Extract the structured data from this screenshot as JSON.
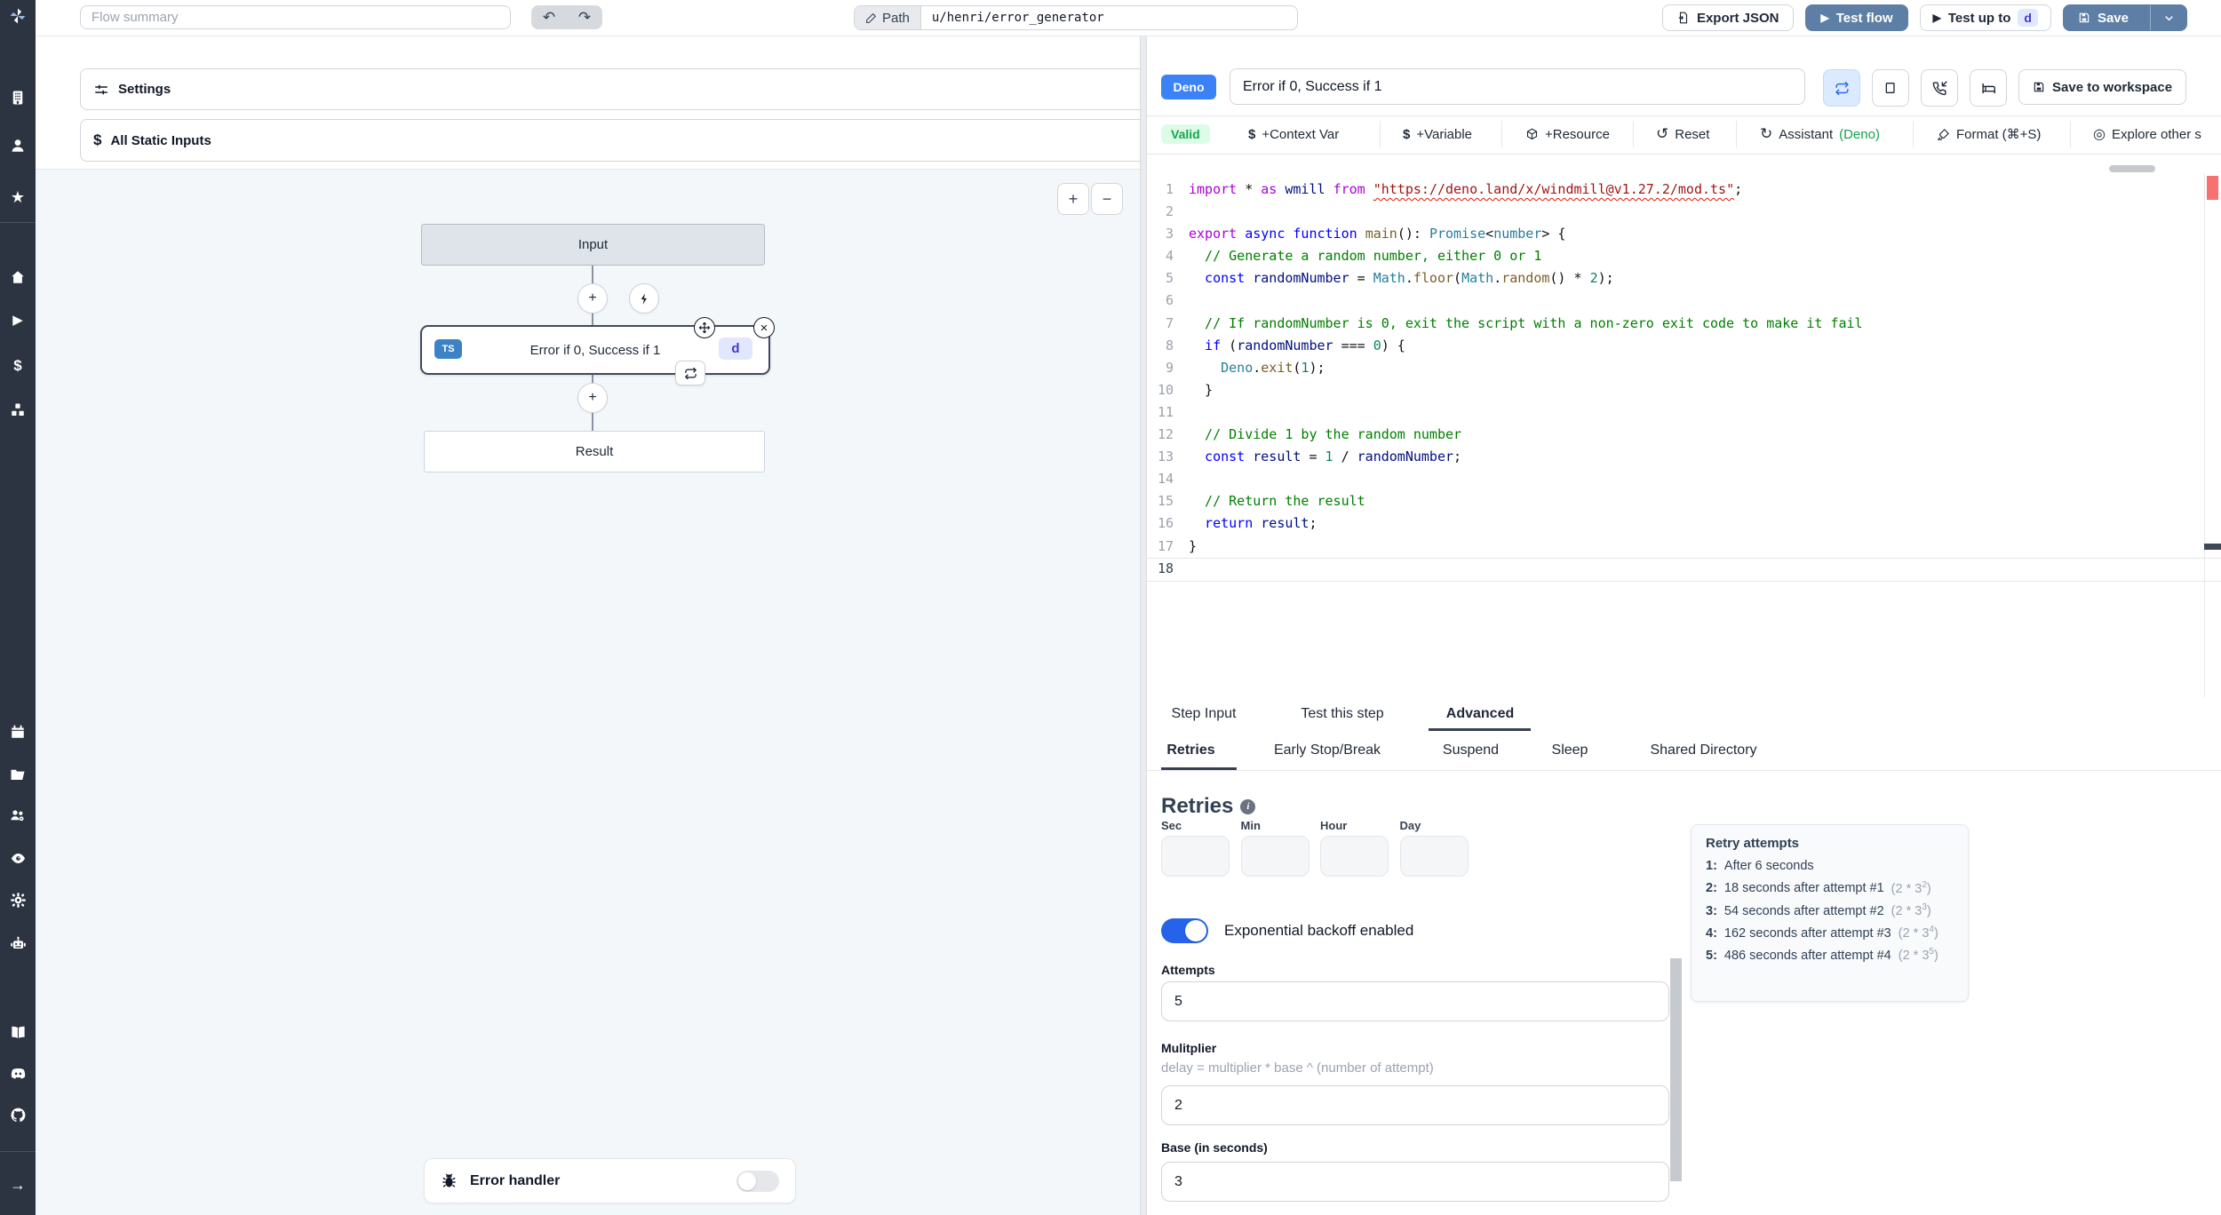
{
  "topbar": {
    "flow_summary_placeholder": "Flow summary",
    "undo_icon": "↶",
    "redo_icon": "↷",
    "path_label": "Path",
    "path_value": "u/henri/error_generator",
    "export_json_label": "Export JSON",
    "test_flow_label": "Test flow",
    "test_up_to_label": "Test up to",
    "test_up_to_badge": "d",
    "save_label": "Save"
  },
  "flow_panel": {
    "settings_label": "Settings",
    "all_static_inputs_label": "All Static Inputs",
    "zoom_in": "+",
    "zoom_out": "−",
    "graph": {
      "input_node": "Input",
      "step_lang_badge": "TS",
      "step_title": "Error if 0, Success if 1",
      "step_id_badge": "d",
      "result_node": "Result"
    },
    "error_handler_label": "Error handler"
  },
  "editor": {
    "lang_badge": "Deno",
    "title_value": "Error if 0, Success if 1",
    "save_to_workspace_label": "Save to workspace",
    "toolbar": {
      "valid": "Valid",
      "context_var": "+Context Var",
      "variable": "+Variable",
      "resource": "+Resource",
      "reset": "Reset",
      "assistant": "Assistant",
      "assistant_lang": "(Deno)",
      "format": "Format (⌘+S)",
      "explore": "Explore other s"
    },
    "code_lines": [
      {
        "n": "1",
        "seg": [
          [
            "kw",
            "import"
          ],
          [
            "pl",
            " * "
          ],
          [
            "kw",
            "as"
          ],
          [
            "pl",
            " "
          ],
          [
            "vr",
            "wmill"
          ],
          [
            "pl",
            " "
          ],
          [
            "kw",
            "from"
          ],
          [
            "pl",
            " "
          ],
          [
            "sq",
            "\"https://deno.land/x/windmill@v1.27.2/mod.ts\""
          ],
          [
            "pl",
            ";"
          ]
        ]
      },
      {
        "n": "2",
        "seg": []
      },
      {
        "n": "3",
        "seg": [
          [
            "kw",
            "export"
          ],
          [
            "pl",
            " "
          ],
          [
            "kw2",
            "async"
          ],
          [
            "pl",
            " "
          ],
          [
            "kw2",
            "function"
          ],
          [
            "pl",
            " "
          ],
          [
            "fn",
            "main"
          ],
          [
            "pl",
            "(): "
          ],
          [
            "ty",
            "Promise"
          ],
          [
            "pl",
            "<"
          ],
          [
            "ty",
            "number"
          ],
          [
            "pl",
            "> {"
          ]
        ]
      },
      {
        "n": "4",
        "seg": [
          [
            "cm",
            "  // Generate a random number, either 0 or 1"
          ]
        ]
      },
      {
        "n": "5",
        "seg": [
          [
            "kw2",
            "  const"
          ],
          [
            "pl",
            " "
          ],
          [
            "vr",
            "randomNumber"
          ],
          [
            "pl",
            " = "
          ],
          [
            "ty",
            "Math"
          ],
          [
            "pl",
            "."
          ],
          [
            "fn",
            "floor"
          ],
          [
            "pl",
            "("
          ],
          [
            "ty",
            "Math"
          ],
          [
            "pl",
            "."
          ],
          [
            "fn",
            "random"
          ],
          [
            "pl",
            "() * "
          ],
          [
            "nm",
            "2"
          ],
          [
            "pl",
            ");"
          ]
        ]
      },
      {
        "n": "6",
        "seg": []
      },
      {
        "n": "7",
        "seg": [
          [
            "cm",
            "  // If randomNumber is 0, exit the script with a non-zero exit code to make it fail"
          ]
        ]
      },
      {
        "n": "8",
        "seg": [
          [
            "kw2",
            "  if"
          ],
          [
            "pl",
            " ("
          ],
          [
            "vr",
            "randomNumber"
          ],
          [
            "pl",
            " === "
          ],
          [
            "nm",
            "0"
          ],
          [
            "pl",
            ") {"
          ]
        ]
      },
      {
        "n": "9",
        "seg": [
          [
            "pl",
            "    "
          ],
          [
            "ty",
            "Deno"
          ],
          [
            "pl",
            "."
          ],
          [
            "fn",
            "exit"
          ],
          [
            "pl",
            "("
          ],
          [
            "nm",
            "1"
          ],
          [
            "pl",
            ");"
          ]
        ]
      },
      {
        "n": "10",
        "seg": [
          [
            "pl",
            "  }"
          ]
        ]
      },
      {
        "n": "11",
        "seg": []
      },
      {
        "n": "12",
        "seg": [
          [
            "cm",
            "  // Divide 1 by the random number"
          ]
        ]
      },
      {
        "n": "13",
        "seg": [
          [
            "kw2",
            "  const"
          ],
          [
            "pl",
            " "
          ],
          [
            "vr",
            "result"
          ],
          [
            "pl",
            " = "
          ],
          [
            "nm",
            "1"
          ],
          [
            "pl",
            " / "
          ],
          [
            "vr",
            "randomNumber"
          ],
          [
            "pl",
            ";"
          ]
        ]
      },
      {
        "n": "14",
        "seg": []
      },
      {
        "n": "15",
        "seg": [
          [
            "cm",
            "  // Return the result"
          ]
        ]
      },
      {
        "n": "16",
        "seg": [
          [
            "kw2",
            "  return"
          ],
          [
            "pl",
            " "
          ],
          [
            "vr",
            "result"
          ],
          [
            "pl",
            ";"
          ]
        ]
      },
      {
        "n": "17",
        "seg": [
          [
            "pl",
            "}"
          ]
        ]
      },
      {
        "n": "18",
        "seg": [],
        "active": true
      }
    ]
  },
  "bottom": {
    "tabs": [
      "Step Input",
      "Test this step",
      "Advanced"
    ],
    "subtabs": [
      "Retries",
      "Early Stop/Break",
      "Suspend",
      "Sleep",
      "Shared Directory"
    ],
    "retries": {
      "heading": "Retries",
      "time_labels": [
        "Sec",
        "Min",
        "Hour",
        "Day"
      ],
      "backoff_label": "Exponential backoff enabled",
      "attempts_label": "Attempts",
      "attempts_value": "5",
      "multiplier_label": "Mulitplier",
      "multiplier_help": "delay = multiplier * base ^ (number of attempt)",
      "multiplier_value": "2",
      "base_label": "Base (in seconds)",
      "base_value": "3",
      "retry_card": {
        "title": "Retry attempts",
        "items": [
          {
            "index": "1:",
            "text": "After 6 seconds",
            "formula_base": "",
            "formula_exp": ""
          },
          {
            "index": "2:",
            "text": "18 seconds after attempt #1",
            "formula_base": "(2 * 3",
            "formula_exp": "2"
          },
          {
            "index": "3:",
            "text": "54 seconds after attempt #2",
            "formula_base": "(2 * 3",
            "formula_exp": "3"
          },
          {
            "index": "4:",
            "text": "162 seconds after attempt #3",
            "formula_base": "(2 * 3",
            "formula_exp": "4"
          },
          {
            "index": "5:",
            "text": "486 seconds after attempt #4",
            "formula_base": "(2 * 3",
            "formula_exp": "5"
          }
        ]
      }
    }
  },
  "colors": {
    "primary_button": "#5d7fa6",
    "deno_badge": "#3b82f6",
    "ts_badge": "#3c82c4",
    "id_badge_bg": "#e0e7ff",
    "id_badge_text": "#4338ca",
    "valid_bg": "#dcfce7",
    "valid_text": "#16a34a",
    "toggle_on": "#2563eb",
    "sidebar_bg": "#2c3341"
  }
}
